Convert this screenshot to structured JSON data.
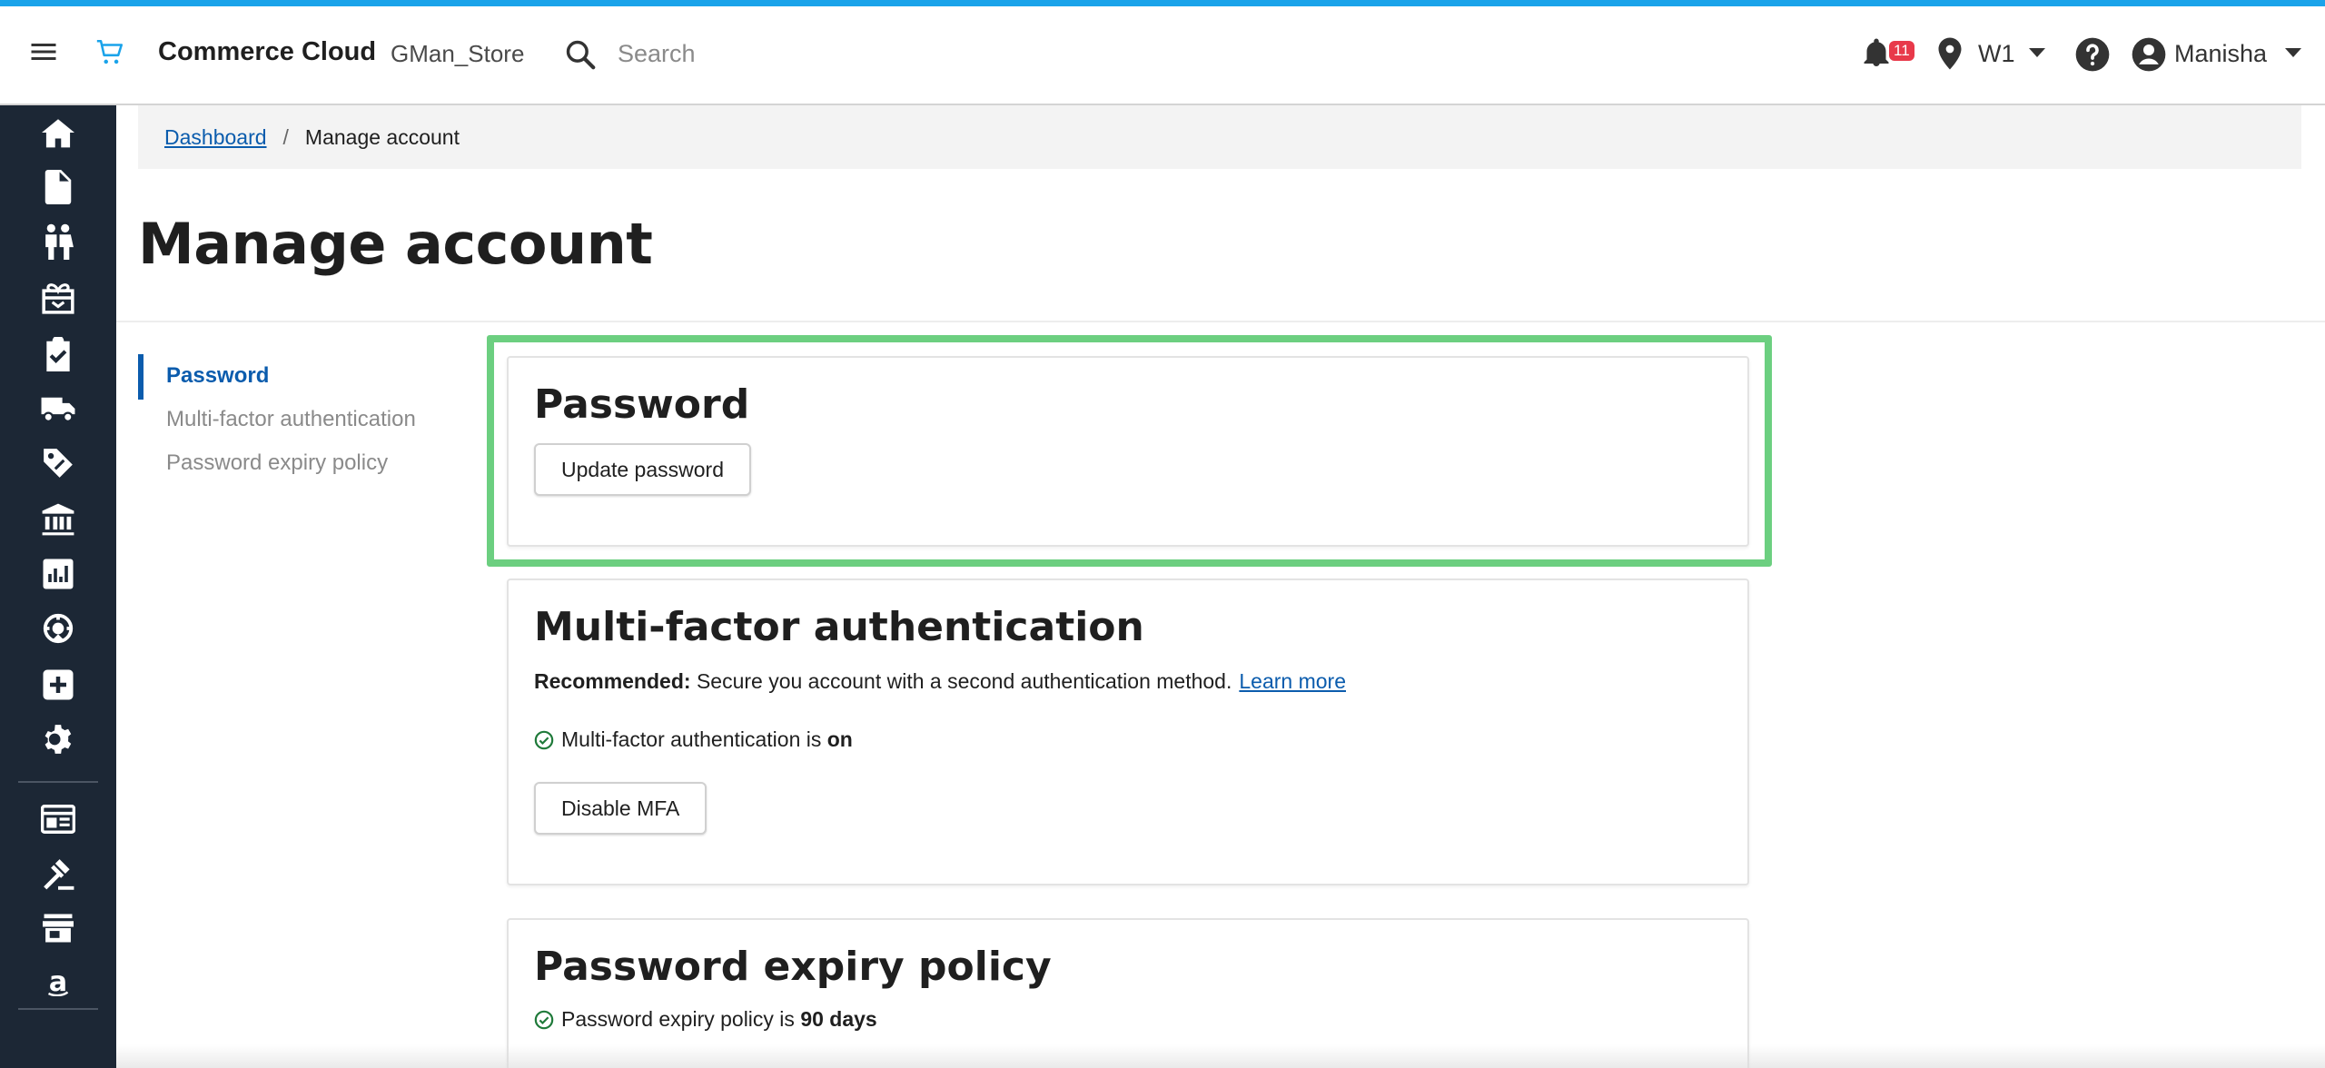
{
  "topbar": {
    "brand": "Commerce Cloud",
    "store": "GMan_Store",
    "search_placeholder": "Search",
    "notifications_count": "11",
    "location": "W1",
    "user": "Manisha"
  },
  "breadcrumb": {
    "root": "Dashboard",
    "separator": "/",
    "current": "Manage account"
  },
  "page": {
    "title": "Manage account"
  },
  "leftnav": {
    "items": [
      {
        "label": "Password",
        "active": true
      },
      {
        "label": "Multi-factor authentication",
        "active": false
      },
      {
        "label": "Password expiry policy",
        "active": false
      }
    ]
  },
  "sections": {
    "password": {
      "title": "Password",
      "button": "Update password"
    },
    "mfa": {
      "title": "Multi-factor authentication",
      "recommended_label": "Recommended:",
      "recommended_text": "Secure you account with a second authentication method.",
      "learn_more": "Learn more",
      "status_text": "Multi-factor authentication is",
      "status_value": "on",
      "button": "Disable MFA"
    },
    "expiry": {
      "title": "Password expiry policy",
      "status_text": "Password expiry policy is",
      "status_value": "90 days"
    }
  },
  "colors": {
    "accent": "#0b5cad",
    "sidebar": "#1c2735",
    "highlight": "#6ccf80",
    "topstripe": "#1aa3ea",
    "badge": "#e8394a"
  },
  "icons": {
    "topbar": [
      "menu-icon",
      "cart-icon",
      "search-icon",
      "bell-icon",
      "location-pin-icon",
      "caret-down-icon",
      "help-icon",
      "user-circle-icon"
    ],
    "sidebar": [
      "home-icon",
      "document-icon",
      "customers-icon",
      "gift-icon",
      "clipboard-check-icon",
      "truck-icon",
      "tag-icon",
      "bank-icon",
      "chart-icon",
      "support-icon",
      "plus-box-icon",
      "gear-icon",
      "layout-icon",
      "gavel-icon",
      "storefront-icon",
      "amazon-icon"
    ]
  }
}
